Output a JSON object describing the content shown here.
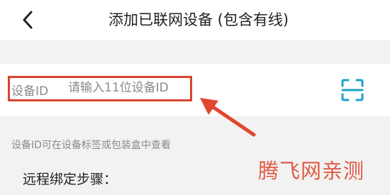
{
  "header": {
    "title": "添加已联网设备 (包含有线)"
  },
  "icons": {
    "back": "chevron-left-icon",
    "scan": "scan-qr-icon"
  },
  "device_id": {
    "label": "设备ID",
    "placeholder": "请输入11位设备ID",
    "value": ""
  },
  "hint": "设备ID可在设备标签或包装盒中查看",
  "steps": {
    "title": "远程绑定步骤："
  },
  "watermark": "腾飞网亲测",
  "colors": {
    "accent": "#1aa3c9",
    "annotation": "#d9442f",
    "watermark": "#e05a43"
  }
}
